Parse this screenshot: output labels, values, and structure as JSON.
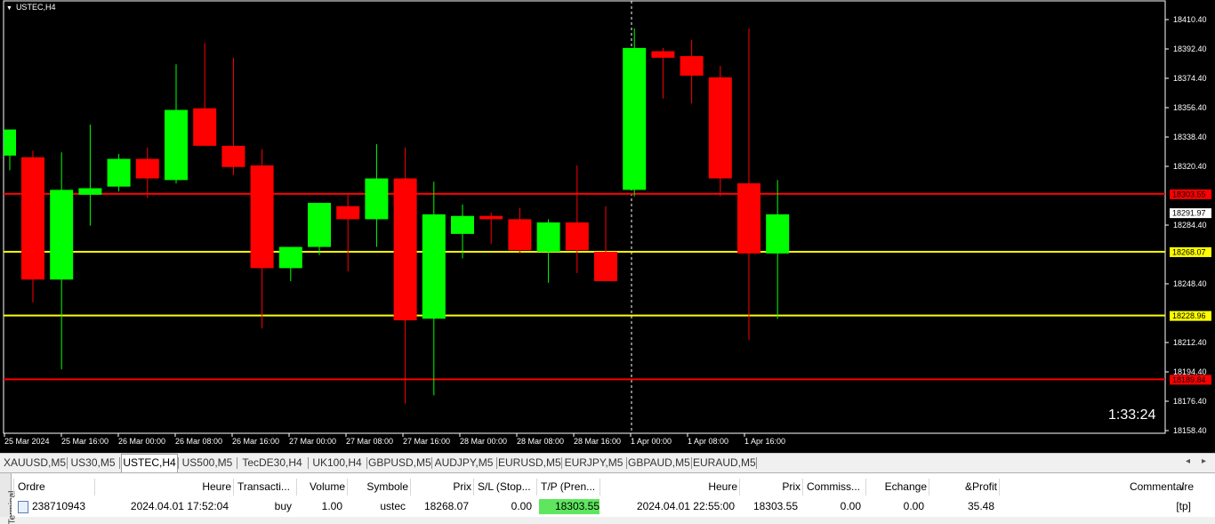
{
  "chart": {
    "title": "USTEC,H4",
    "timer": "1:33:24",
    "colors": {
      "bull": "#00ff00",
      "bear": "#ff0000",
      "support": "#ffff00",
      "resistance": "#ff0000",
      "background": "#000000",
      "axis": "#ffffff"
    },
    "price_ticks": [
      "18410.40",
      "18392.40",
      "18374.40",
      "18356.40",
      "18338.40",
      "18320.40",
      "18284.40",
      "18248.40",
      "18212.40",
      "18194.40",
      "18176.40",
      "18158.40"
    ],
    "time_labels": [
      "25 Mar 2024",
      "25 Mar 16:00",
      "26 Mar 00:00",
      "26 Mar 08:00",
      "26 Mar 16:00",
      "27 Mar 00:00",
      "27 Mar 08:00",
      "27 Mar 16:00",
      "28 Mar 00:00",
      "28 Mar 08:00",
      "28 Mar 16:00",
      "1 Apr 00:00",
      "1 Apr 08:00",
      "1 Apr 16:00"
    ],
    "levels": [
      {
        "label": "18303.55",
        "price": 18303.55,
        "kind": "resistance"
      },
      {
        "label": "18291.97",
        "price": 18291.97,
        "kind": "current"
      },
      {
        "label": "18268.07",
        "price": 18268.07,
        "kind": "support"
      },
      {
        "label": "18228.96",
        "price": 18228.96,
        "kind": "support"
      },
      {
        "label": "18189.84",
        "price": 18189.84,
        "kind": "resistance"
      }
    ]
  },
  "chart_data": {
    "type": "candlestick",
    "title": "USTEC,H4",
    "ylim": [
      18150,
      18415
    ],
    "candles": [
      {
        "o": 18327.0,
        "h": 18333.0,
        "l": 18318.0,
        "c": 18343.0
      },
      {
        "o": 18326.0,
        "h": 18330.0,
        "l": 18237.0,
        "c": 18251.0
      },
      {
        "o": 18251.0,
        "h": 18329.0,
        "l": 18196.0,
        "c": 18306.0
      },
      {
        "o": 18303.0,
        "h": 18346.0,
        "l": 18284.0,
        "c": 18307.0
      },
      {
        "o": 18308.0,
        "h": 18328.0,
        "l": 18305.0,
        "c": 18325.0
      },
      {
        "o": 18325.0,
        "h": 18332.0,
        "l": 18301.0,
        "c": 18313.0
      },
      {
        "o": 18312.0,
        "h": 18383.0,
        "l": 18310.0,
        "c": 18355.0
      },
      {
        "o": 18356.0,
        "h": 18396.0,
        "l": 18334.0,
        "c": 18333.0
      },
      {
        "o": 18333.0,
        "h": 18387.0,
        "l": 18315.0,
        "c": 18320.0
      },
      {
        "o": 18321.0,
        "h": 18331.0,
        "l": 18221.0,
        "c": 18258.0
      },
      {
        "o": 18258.0,
        "h": 18270.0,
        "l": 18250.0,
        "c": 18271.0
      },
      {
        "o": 18271.0,
        "h": 18293.0,
        "l": 18266.0,
        "c": 18298.0
      },
      {
        "o": 18296.0,
        "h": 18304.0,
        "l": 18256.0,
        "c": 18288.0
      },
      {
        "o": 18288.0,
        "h": 18334.0,
        "l": 18271.0,
        "c": 18313.0
      },
      {
        "o": 18313.0,
        "h": 18332.0,
        "l": 18175.0,
        "c": 18226.0
      },
      {
        "o": 18227.0,
        "h": 18311.0,
        "l": 18180.0,
        "c": 18291.0
      },
      {
        "o": 18279.0,
        "h": 18297.0,
        "l": 18264.0,
        "c": 18290.0
      },
      {
        "o": 18290.0,
        "h": 18292.0,
        "l": 18273.0,
        "c": 18288.0
      },
      {
        "o": 18288.0,
        "h": 18295.0,
        "l": 18267.0,
        "c": 18269.0
      },
      {
        "o": 18268.0,
        "h": 18288.0,
        "l": 18249.0,
        "c": 18286.0
      },
      {
        "o": 18286.0,
        "h": 18321.0,
        "l": 18255.0,
        "c": 18269.0
      },
      {
        "o": 18268.0,
        "h": 18296.0,
        "l": 18252.0,
        "c": 18250.0
      },
      {
        "o": 18306.0,
        "h": 18405.0,
        "l": 18302.0,
        "c": 18393.0
      },
      {
        "o": 18391.0,
        "h": 18393.0,
        "l": 18362.0,
        "c": 18387.0
      },
      {
        "o": 18388.0,
        "h": 18398.0,
        "l": 18359.0,
        "c": 18376.0
      },
      {
        "o": 18375.0,
        "h": 18382.0,
        "l": 18302.0,
        "c": 18313.0
      },
      {
        "o": 18310.0,
        "h": 18405.0,
        "l": 18214.0,
        "c": 18267.0
      },
      {
        "o": 18267.0,
        "h": 18312.0,
        "l": 18227.0,
        "c": 18291.0
      }
    ]
  },
  "symbol_tabs": [
    {
      "label": "XAUUSD,M5",
      "active": false
    },
    {
      "label": "US30,M5",
      "active": false
    },
    {
      "label": "USTEC,H4",
      "active": true
    },
    {
      "label": "US500,M5",
      "active": false
    },
    {
      "label": "TecDE30,H4",
      "active": false
    },
    {
      "label": "UK100,H4",
      "active": false
    },
    {
      "label": "GBPUSD,M5",
      "active": false
    },
    {
      "label": "AUDJPY,M5",
      "active": false
    },
    {
      "label": "EURUSD,M5",
      "active": false
    },
    {
      "label": "EURJPY,M5",
      "active": false
    },
    {
      "label": "GBPAUD,M5",
      "active": false
    },
    {
      "label": "EURAUD,M5",
      "active": false
    }
  ],
  "terminal": {
    "side_label": "Terminal",
    "headers": [
      "Ordre",
      "Heure",
      "Transacti...",
      "Volume",
      "Symbole",
      "Prix",
      "S/L (Stop...",
      "T/P (Pren...",
      "Heure",
      "Prix",
      "Commiss...",
      "Echange",
      "&Profit",
      "Commentaire"
    ],
    "sort_indicator": "/",
    "row": [
      "238710943",
      "2024.04.01 17:52:04",
      "buy",
      "1.00",
      "ustec",
      "18268.07",
      "0.00",
      "18303.55",
      "2024.04.01 22:55:00",
      "18303.55",
      "0.00",
      "0.00",
      "35.48",
      "[tp]"
    ]
  }
}
